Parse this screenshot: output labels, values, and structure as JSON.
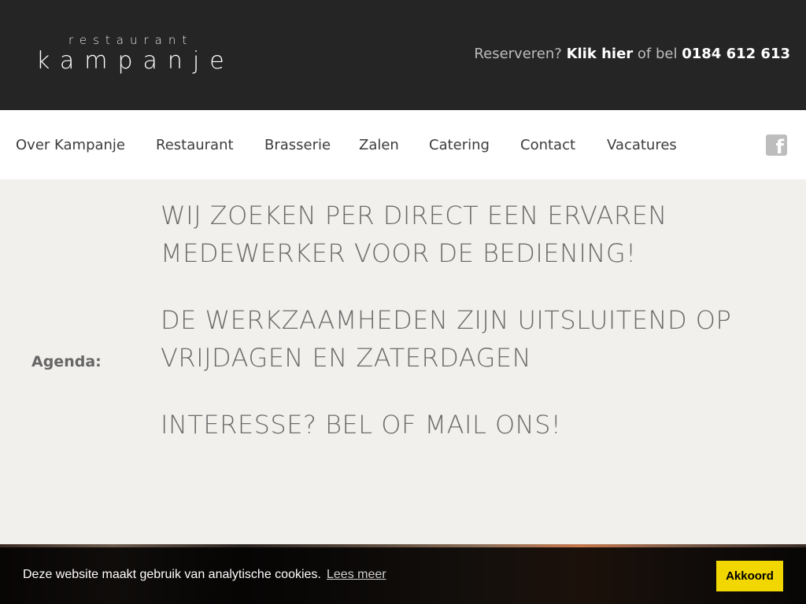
{
  "header": {
    "logo_top": "restaurant",
    "logo_main": "kampanje",
    "reserve_prefix": "Reserveren?",
    "reserve_link": "Klik hier",
    "reserve_middle": "of bel",
    "phone": "0184 612 613"
  },
  "nav": {
    "items": [
      {
        "label": "Over Kampanje"
      },
      {
        "label": "Restaurant"
      },
      {
        "label": "Brasserie"
      },
      {
        "label": "Zalen"
      },
      {
        "label": "Catering"
      },
      {
        "label": "Contact"
      },
      {
        "label": "Vacatures"
      }
    ],
    "facebook_icon": "facebook-icon"
  },
  "main": {
    "agenda_label": "Agenda:",
    "messages": [
      "WIJ ZOEKEN PER DIRECT EEN ERVAREN MEDEWERKER VOOR DE BEDIENING!",
      "DE WERKZAAMHEDEN ZIJN UITSLUITEND OP VRIJDAGEN EN ZATERDAGEN",
      "INTERESSE? BEL OF MAIL ONS!"
    ]
  },
  "cookie": {
    "text": "Deze website maakt gebruik van analytische cookies.",
    "link": "Lees meer",
    "button": "Akkoord"
  },
  "colors": {
    "header_bg": "#252525",
    "page_bg": "#f1f0ed",
    "accent_button": "#f1d600"
  }
}
